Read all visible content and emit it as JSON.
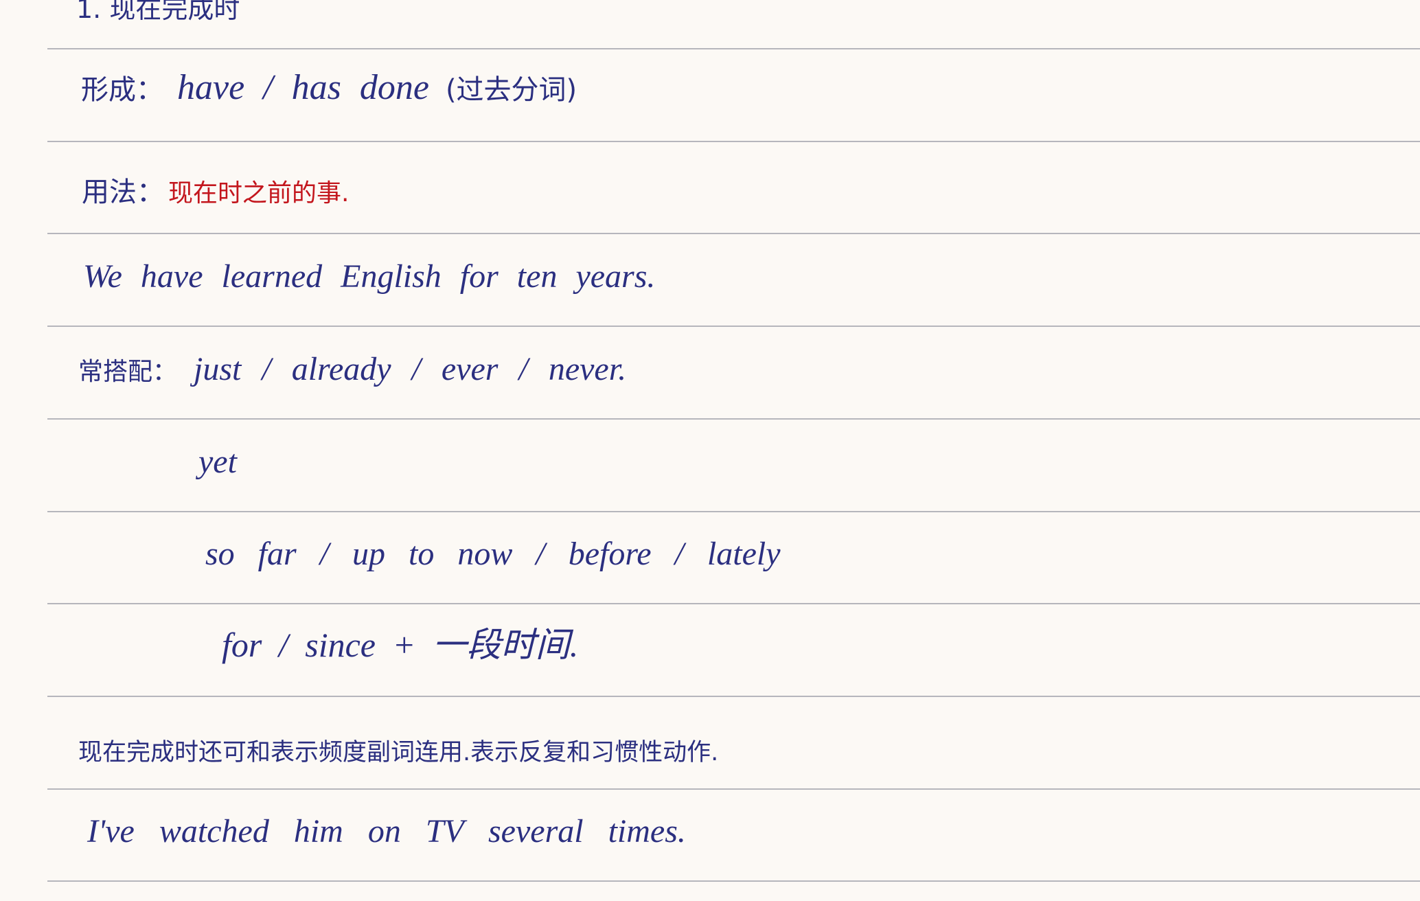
{
  "note": {
    "heading": "1. 现在完成时",
    "form": {
      "label": "形成：",
      "text": "have / has done",
      "note": "(过去分词)"
    },
    "usage": {
      "label": "用法：",
      "text": "现在时之前的事."
    },
    "example1": "We have learned English for ten years.",
    "collocations": {
      "label": "常搭配：",
      "lines": [
        "just / already / ever / never.",
        "yet",
        "so far / up to now / before / lately",
        "for / since + 一段时间."
      ]
    },
    "frequency_note": "现在完成时还可和表示频度副词连用.表示反复和习惯性动作.",
    "example2": "I've watched him on TV several times."
  },
  "colors": {
    "paper": "#fcf9f5",
    "rule": "#b6b6bc",
    "ink": "#2b2f80",
    "highlight": "#c3161d"
  }
}
